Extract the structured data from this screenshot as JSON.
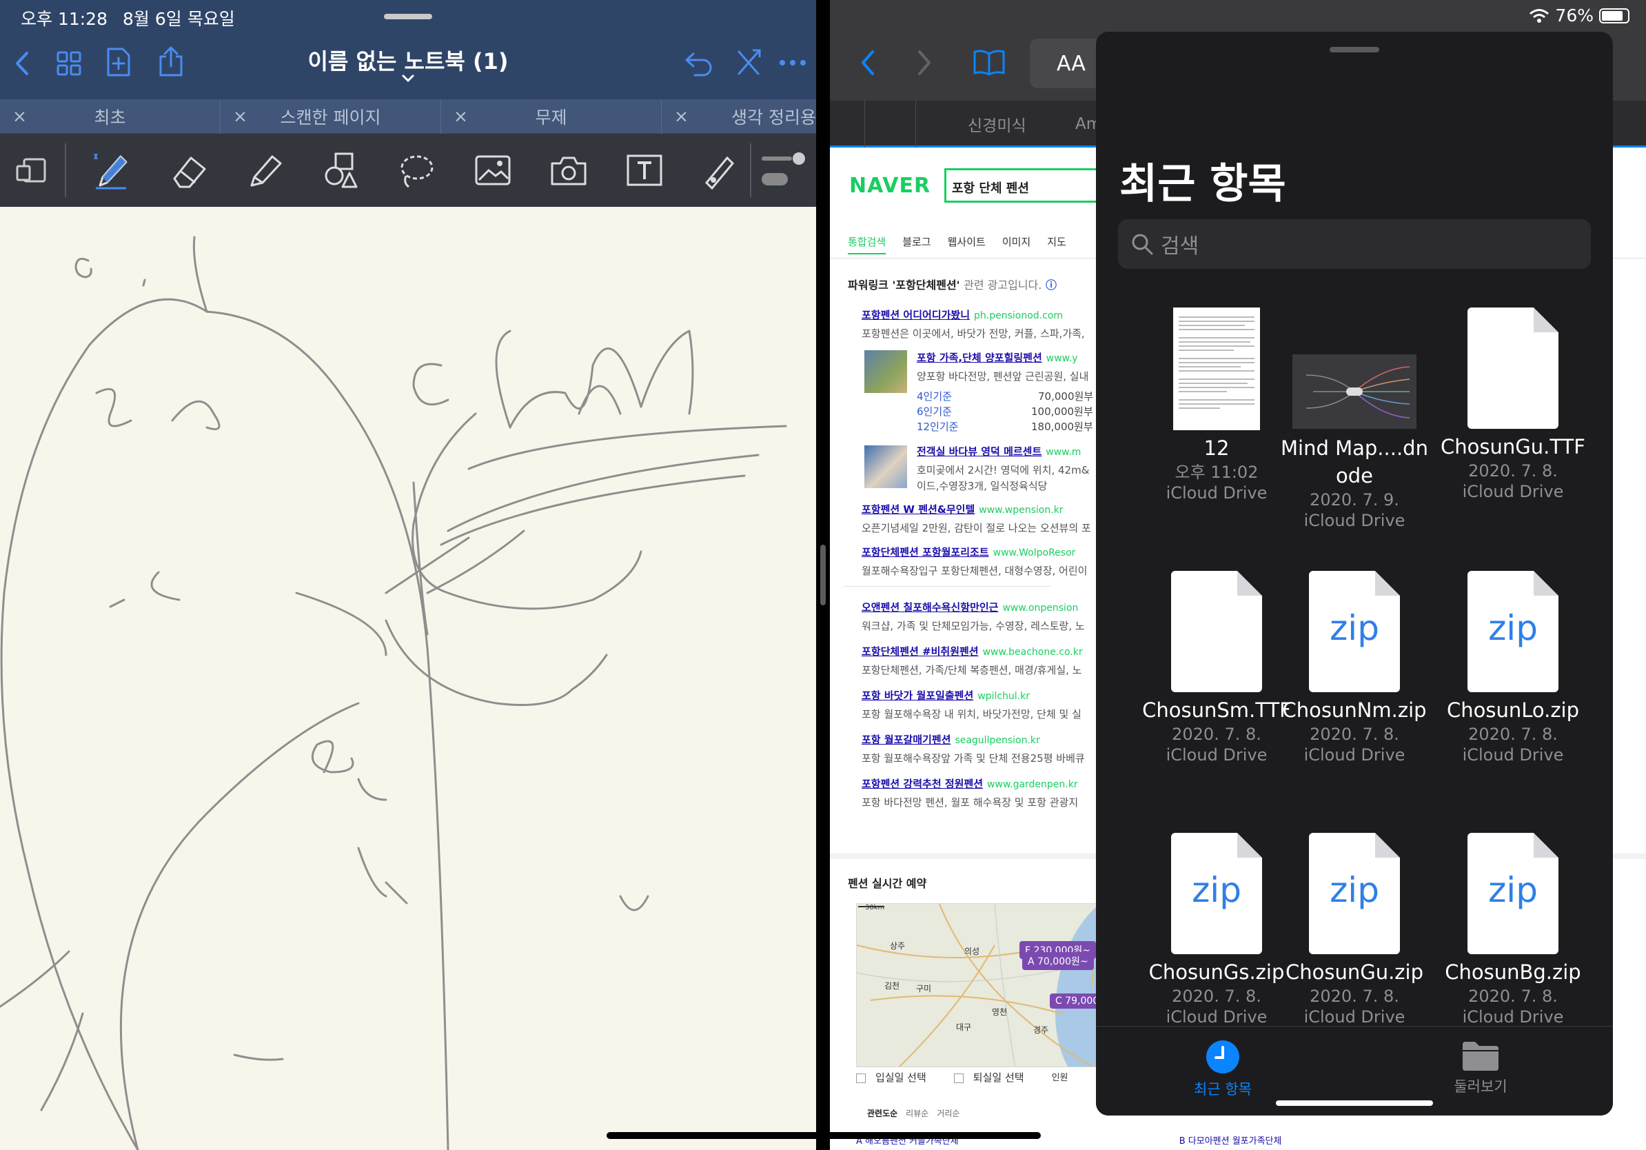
{
  "status_bar": {
    "time": "오후 11:28",
    "date": "8월 6일 목요일",
    "battery": "76%",
    "battery_level": 0.76
  },
  "goodnotes": {
    "title": "이름 없는 노트북 (1)",
    "tabs": [
      {
        "label": "최초"
      },
      {
        "label": "스캔한 페이지"
      },
      {
        "label": "무제"
      },
      {
        "label": "생각 정리용"
      }
    ],
    "tab_close": "×"
  },
  "safari": {
    "aa_label": "AA",
    "tabs": [
      {
        "label": "신경미식"
      },
      {
        "label": "Am"
      }
    ]
  },
  "naver": {
    "logo": "NAVER",
    "query": "포항 단체 펜션",
    "tabs": [
      "통합검색",
      "블로그",
      "웹사이트",
      "이미지",
      "지도"
    ],
    "powerlink_title": "파워링크 '포항단체펜션'",
    "powerlink_sub": "관련 광고입니다.",
    "ads": [
      {
        "title": "포항펜션 어디어디가봤니",
        "url": "ph.pensionod.com",
        "desc": "포항펜션은 이곳에서, 바닷가 전망, 커플, 스파,가족,"
      },
      {
        "title": "포항 가족,단체 양포힐링펜션",
        "url": "www.y",
        "desc": "양포항 바다전망, 펜션앞 근린공원, 실내"
      },
      {
        "title": "전객실 바다뷰 영덕 메르센트",
        "url": "www.m",
        "desc": "호미곶에서 2시간! 영덕에 위치, 42m&",
        "desc2": "이드,수영장3개, 일식정육식당"
      },
      {
        "title": "포항펜션 W 펜션&무인텔",
        "url": "www.wpension.kr",
        "desc": "오픈기념세일 2만원, 감탄이 절로 나오는 오션뷰의 포"
      },
      {
        "title": "포항단체펜션 포항월포리조트",
        "url": "www.WolpoResor",
        "desc": "월포해수욕장입구 포항단체펜션, 대형수영장, 어린이"
      },
      {
        "title": "오앤펜션 칠포해수욕신항만인근",
        "url": "www.onpension",
        "desc": "워크샵, 가족 및 단체모임가능, 수영장, 레스토랑, 노"
      },
      {
        "title": "포항단체펜션 #비취원펜션",
        "url": "www.beachone.co.kr",
        "desc": "포항단체펜션, 가족/단체 복층펜션, 매경/휴게실, 노"
      },
      {
        "title": "포항 바닷가 월포일출펜션",
        "url": "wpilchul.kr",
        "desc": "포항 월포해수욕장 내 위치, 바닷가전망, 단체 및 실"
      },
      {
        "title": "포항 월포갈매기펜션",
        "url": "seagullpension.kr",
        "desc": "포항 월포해수욕장앞 가족 및 단체 전용25평 바베큐"
      },
      {
        "title": "포항펜션 강력추천 정원펜션",
        "url": "www.gardenpen.kr",
        "desc": "포항 바다전망 펜션, 월포 해수욕장 및 포항 관광지"
      }
    ],
    "prices": [
      {
        "label": "4인기준",
        "value": "70,000원부"
      },
      {
        "label": "6인기준",
        "value": "100,000원부"
      },
      {
        "label": "12인기준",
        "value": "180,000원부"
      }
    ],
    "map_title": "펜션 실시간 예약",
    "map_scale": "30km",
    "map_places": [
      "상주",
      "의성",
      "김천",
      "구미",
      "영천",
      "대구",
      "경주"
    ],
    "map_pins": [
      "F 230,000원~",
      "A 70,000원~",
      "C 79,000"
    ],
    "checkin": "입실일 선택",
    "checkout": "퇴실일 선택",
    "guests": "인원",
    "sort": [
      "관련도순",
      "리뷰순",
      "거리순"
    ],
    "bottom": [
      "A 해오름펜션 커플가족단체",
      "B 다모아펜션 월포가족단체"
    ]
  },
  "files": {
    "title": "최근 항목",
    "search_placeholder": "검색",
    "items": [
      {
        "name": "12",
        "date": "오후 11:02",
        "location": "iCloud Drive",
        "kind": "doc-text"
      },
      {
        "name": "Mind Map....dnode",
        "date": "2020. 7. 9.",
        "location": "iCloud Drive",
        "kind": "mindmap"
      },
      {
        "name": "ChosunGu.TTF",
        "date": "2020. 7. 8.",
        "location": "iCloud Drive",
        "kind": "doc"
      },
      {
        "name": "ChosunSm.TTF",
        "date": "2020. 7. 8.",
        "location": "iCloud Drive",
        "kind": "doc"
      },
      {
        "name": "ChosunNm.zip",
        "date": "2020. 7. 8.",
        "location": "iCloud Drive",
        "kind": "zip"
      },
      {
        "name": "ChosunLo.zip",
        "date": "2020. 7. 8.",
        "location": "iCloud Drive",
        "kind": "zip"
      },
      {
        "name": "ChosunGs.zip",
        "date": "2020. 7. 8.",
        "location": "iCloud Drive",
        "kind": "zip"
      },
      {
        "name": "ChosunGu.zip",
        "date": "2020. 7. 8.",
        "location": "iCloud Drive",
        "kind": "zip"
      },
      {
        "name": "ChosunBg.zip",
        "date": "2020. 7. 8.",
        "location": "iCloud Drive",
        "kind": "zip"
      }
    ],
    "zip_label": "zip",
    "tab_recent": "최근 항목",
    "tab_browse": "둘러보기",
    "accent": "#0a84ff"
  }
}
